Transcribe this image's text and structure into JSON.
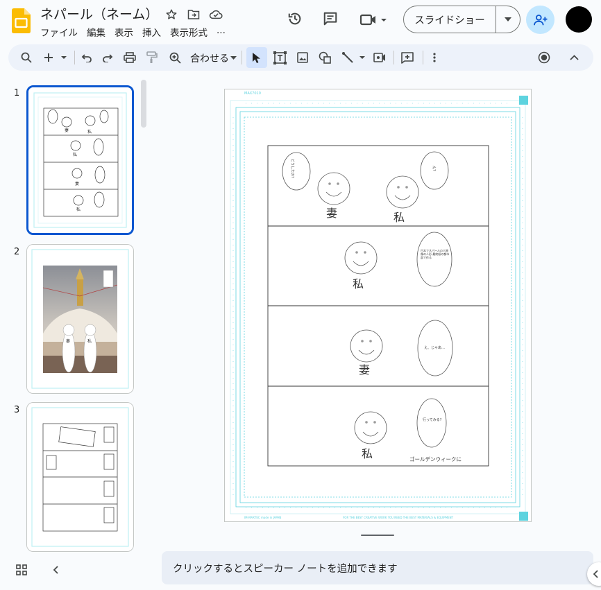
{
  "app": {
    "title": "ネパール（ネーム）",
    "menu": [
      "ファイル",
      "編集",
      "表示",
      "挿入",
      "表示形式",
      "..."
    ],
    "slideshow_label": "スライドショー",
    "speaker_notes_placeholder": "クリックするとスピーカー ノートを追加できます"
  },
  "toolbar": {
    "zoom_label": "合わせる"
  },
  "filmstrip": {
    "slides": [
      {
        "number": "1",
        "selected": true
      },
      {
        "number": "2",
        "selected": false
      },
      {
        "number": "3",
        "selected": false
      }
    ]
  },
  "slide": {
    "panel1": {
      "label_left": "妻",
      "label_right": "私",
      "bubble_left": "どうしたの?",
      "bubble_right": "ん?"
    },
    "panel2": {
      "label": "私",
      "bubble": "日本でネパールの人物像の人形 最終紙の都市部で作る"
    },
    "panel3": {
      "label": "妻",
      "bubble": "え、じゃあ…"
    },
    "panel4": {
      "label": "私",
      "bubble": "行ってみる?",
      "caption": "ゴールデンウィークに"
    },
    "paper_header": "MAX7010",
    "paper_footer_left": "IM-MAXTEC made in JAPAN",
    "paper_footer_right": "FOR THE BEST CREATIVE WORK YOU NEED THE BEST MATERIALS & EQUIPMENT"
  },
  "thumb2": {
    "label_left": "妻",
    "label_right": "私"
  },
  "colors": {
    "accent": "#0b57d0",
    "guide_cyan": "#5ed3df",
    "toolbar_bg": "#edf2fa",
    "share_bg": "#c2e7ff"
  }
}
